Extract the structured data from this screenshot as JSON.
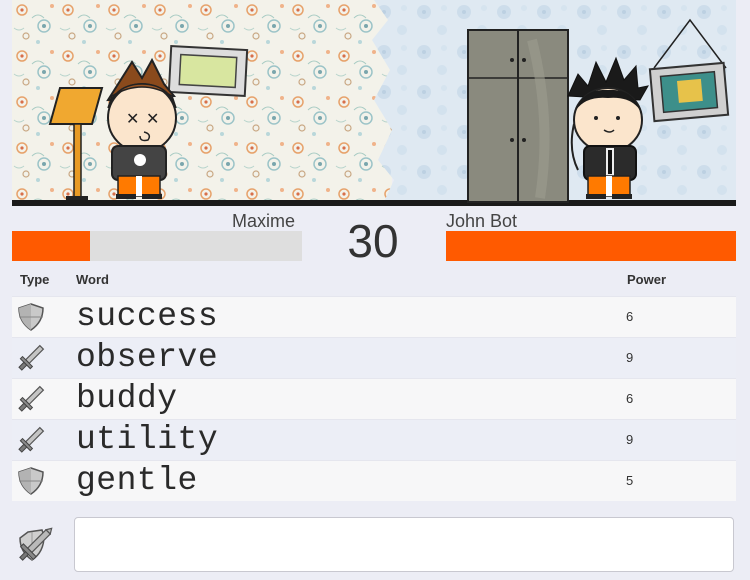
{
  "players": {
    "left": {
      "name": "Maxime",
      "health_fraction": 0.27,
      "color": "#ff5a00"
    },
    "right": {
      "name": "John Bot",
      "health_fraction": 1.0,
      "color": "#ff5a00"
    }
  },
  "timer": "30",
  "table": {
    "headers": {
      "type": "Type",
      "word": "Word",
      "power": "Power"
    },
    "rows": [
      {
        "type": "shield-icon",
        "word": "success",
        "power": "6"
      },
      {
        "type": "sword-icon",
        "word": "observe",
        "power": "9"
      },
      {
        "type": "sword-icon",
        "word": "buddy",
        "power": "6"
      },
      {
        "type": "sword-icon",
        "word": "utility",
        "power": "9"
      },
      {
        "type": "shield-icon",
        "word": "gentle",
        "power": "5"
      }
    ]
  },
  "input": {
    "value": "",
    "placeholder": "",
    "icon": "sword-shield-icon"
  }
}
